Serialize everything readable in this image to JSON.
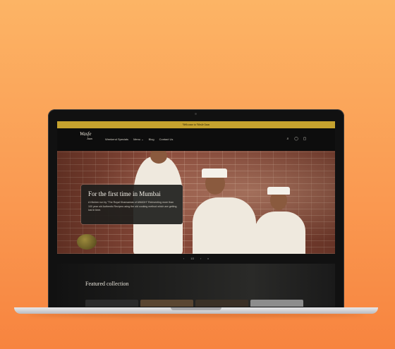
{
  "announcement": "Welcome to Wasfe Jaan",
  "logo": {
    "line1": "Wasfe",
    "line2": "Jaan"
  },
  "nav": {
    "items": [
      "Weekend Specials",
      "Menu",
      "Blog",
      "Contact Us"
    ],
    "menu_chevron": "chevron-down-icon"
  },
  "nav_icons": {
    "search": "search-icon",
    "account": "user-icon",
    "cart": "cart-icon"
  },
  "hero": {
    "title": "For the first time in Mumbai",
    "text": "A Kitchen run by \"The Royal Khansamas of AWADH\" Reinventing more than 100 year old Authentic Recipes using the old cooking method which are getting lost in time."
  },
  "pager": {
    "prev": "‹",
    "current": "1/3",
    "next": "›",
    "pause": "⏸"
  },
  "featured": {
    "title": "Featured collection"
  },
  "colors": {
    "announcement_bg": "#c5a22e",
    "background": "#fa9a52"
  }
}
